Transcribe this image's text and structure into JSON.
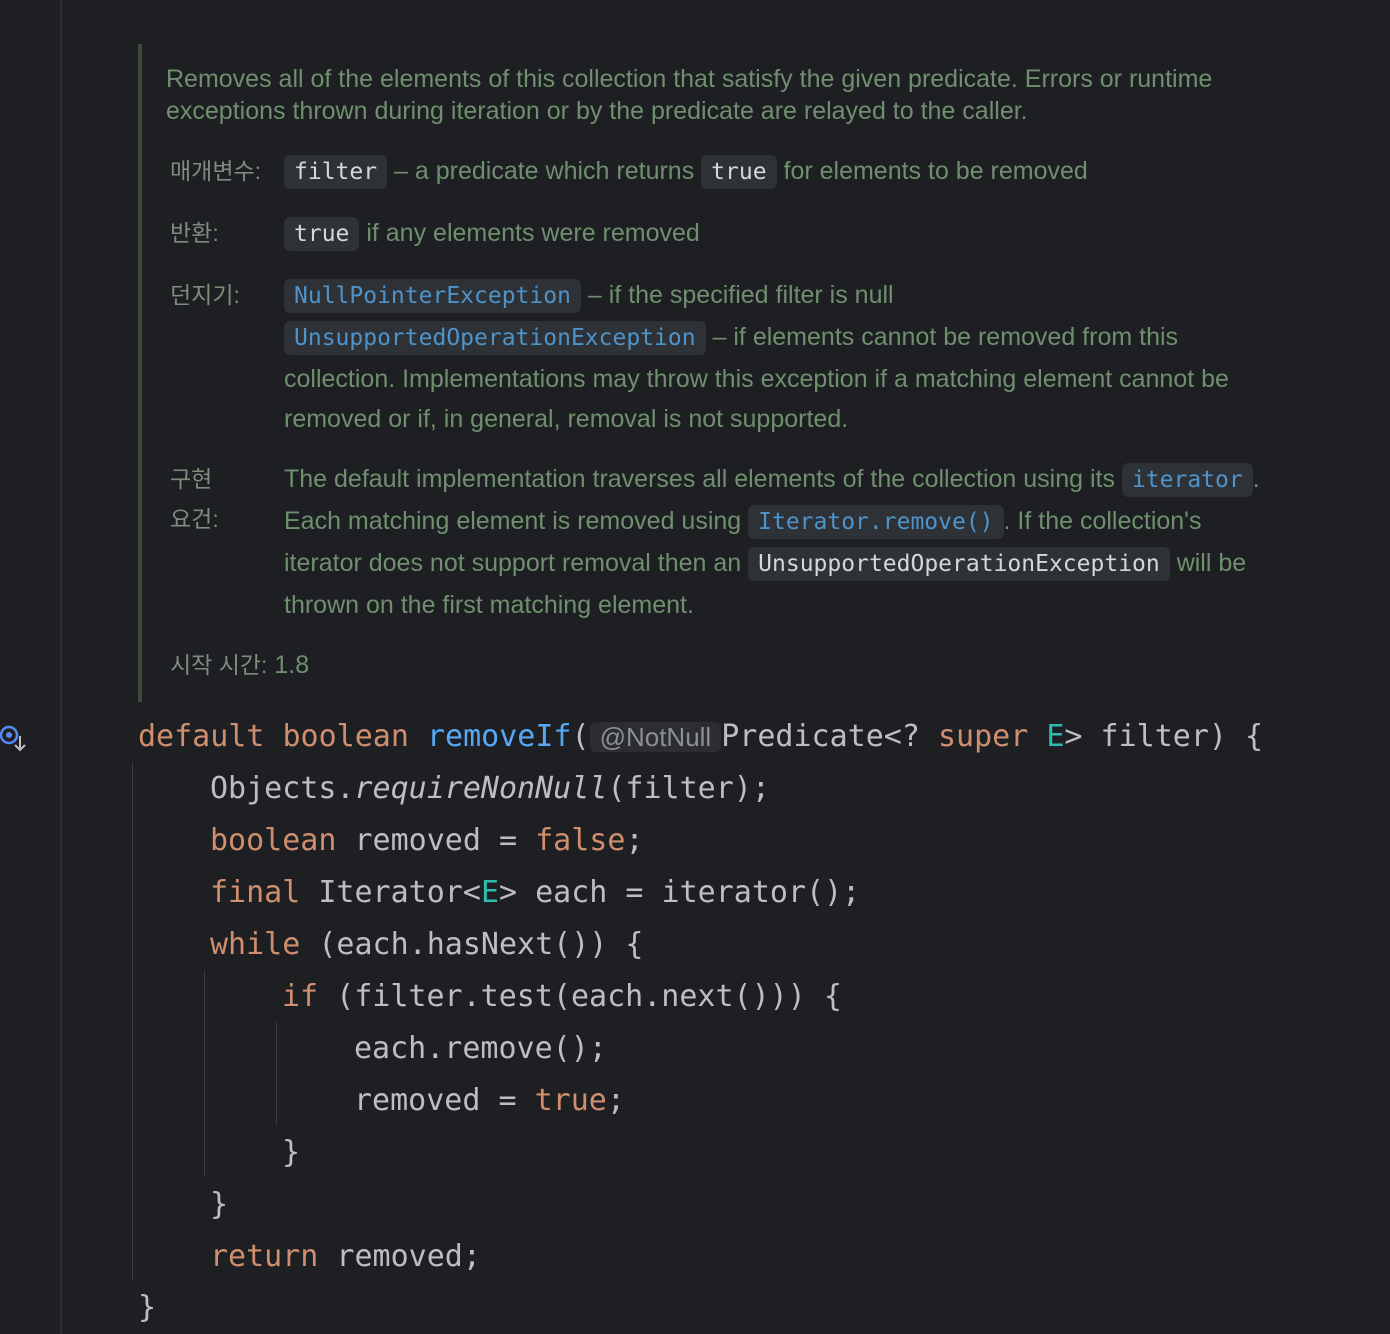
{
  "doc": {
    "summary_line1": "Removes all of the elements of this collection that satisfy the given predicate. Errors or runtime",
    "summary_line2": "exceptions thrown during iteration or by the predicate are relayed to the caller.",
    "params": {
      "label": "매개변수:",
      "chip1": "filter",
      "text1": " – a predicate which returns ",
      "chip2": "true",
      "text2": " for elements to be removed"
    },
    "returns": {
      "label": "반환:",
      "chip": "true",
      "text": " if any elements were removed"
    },
    "throws": {
      "label": "던지기:",
      "chip1": "NullPointerException",
      "text1": " – if the specified filter is null",
      "chip2": "UnsupportedOperationException",
      "text2": " – if elements cannot be removed from this",
      "line3": "collection. Implementations may throw this exception if a matching element cannot be",
      "line4": "removed or if, in general, removal is not supported."
    },
    "impl": {
      "label_line1": "구현",
      "label_line2": "요건:",
      "l1_text": "The default implementation traverses all elements of the collection using its ",
      "l1_chip": "iterator",
      "l1_end": ".",
      "l2_text": "Each matching element is removed using ",
      "l2_chip": "Iterator.remove()",
      "l2_end": ". If the collection's",
      "l3_text": "iterator does not support removal then an ",
      "l3_chip": "UnsupportedOperationException",
      "l3_end": " will be",
      "l4_text": "thrown on the first matching element."
    },
    "since": {
      "label": "시작 시간:",
      "value": " 1.8"
    }
  },
  "code": {
    "sig_default": "default",
    "sig_boolean": "boolean",
    "sig_name": "removeIf",
    "sig_paren": "(",
    "sig_anno": "@NotNull",
    "sig_type": "Predicate<? ",
    "sig_super": "super",
    "sig_E": "E",
    "sig_rest": "> filter) {",
    "l1_a": "Objects.",
    "l1_b": "requireNonNull",
    "l1_c": "(filter);",
    "l2_kw": "boolean",
    "l2_mid": " removed = ",
    "l2_val": "false",
    "l2_end": ";",
    "l3_kw": "final",
    "l3_a": " Iterator<",
    "l3_E": "E",
    "l3_b": "> each = iterator();",
    "l4_kw": "while",
    "l4_rest": " (each.hasNext()) {",
    "l5_kw": "if",
    "l5_rest": " (filter.test(each.next())) {",
    "l6": "each.remove();",
    "l7_a": "removed = ",
    "l7_val": "true",
    "l7_end": ";",
    "l8": "}",
    "l9": "}",
    "l10_kw": "return",
    "l10_rest": " removed;",
    "l11": "}"
  },
  "icons": {
    "gutter": "overrides-method-icon"
  },
  "colors": {
    "background": "#1e1f22",
    "keyword": "#cf8e6d",
    "function": "#56a8f5",
    "type_param": "#2fbcb0",
    "doc_text": "#6f8f6f"
  }
}
